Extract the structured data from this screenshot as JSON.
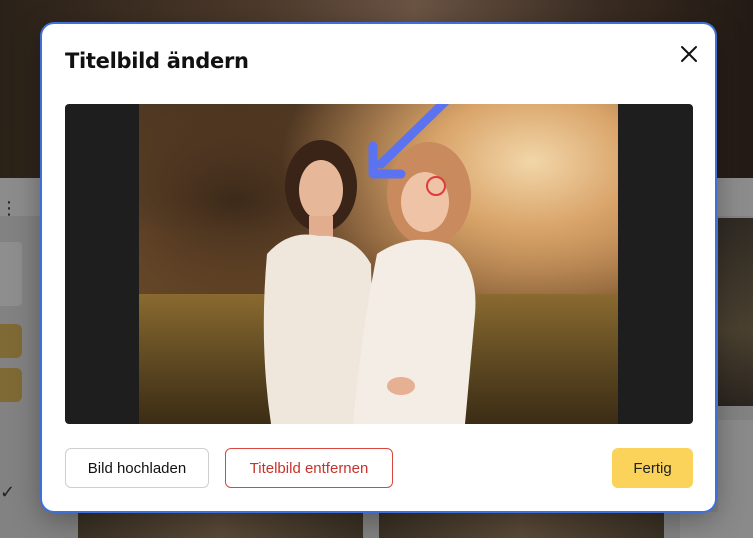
{
  "modal": {
    "title": "Titelbild ändern",
    "close_icon": "close-icon"
  },
  "preview": {
    "focus_marker_color": "#e03b3b",
    "arrow_color": "#5b73f0"
  },
  "buttons": {
    "upload_label": "Bild hochladen",
    "remove_label": "Titelbild entfernen",
    "done_label": "Fertig"
  },
  "colors": {
    "accent": "#fbd35a",
    "danger": "#c8322a",
    "focus_ring": "#3f6fd8"
  },
  "background": {
    "kebab_icon": "more-vertical-icon",
    "check_icon": "check-icon"
  }
}
